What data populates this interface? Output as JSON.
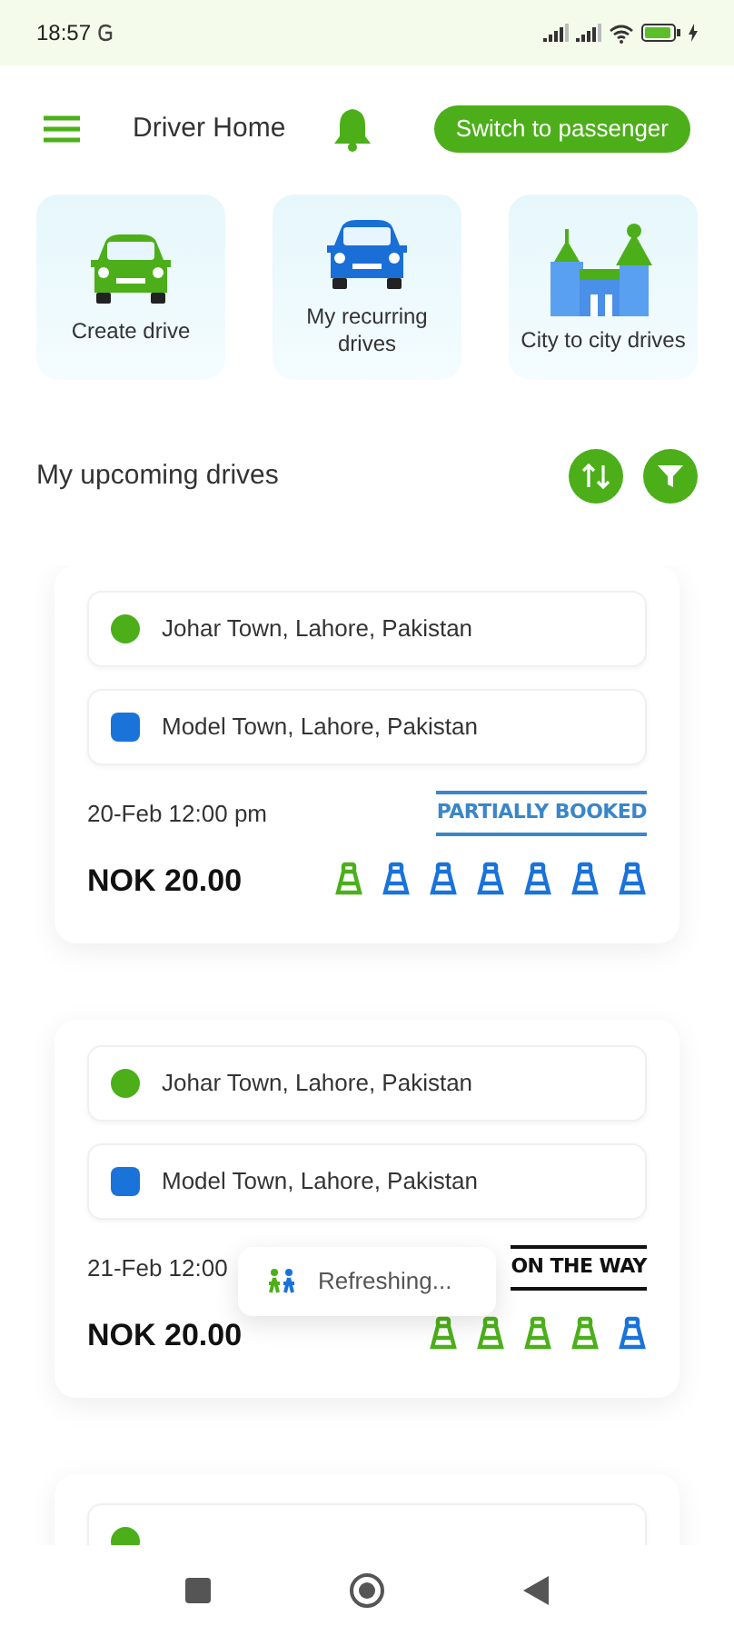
{
  "status_bar": {
    "time": "18:57"
  },
  "header": {
    "title": "Driver Home",
    "switch_button": "Switch to passenger"
  },
  "tiles": [
    {
      "label": "Create drive",
      "kind": "green-car"
    },
    {
      "label": "My recurring drives",
      "kind": "blue-car"
    },
    {
      "label": "City to city drives",
      "kind": "city"
    }
  ],
  "section": {
    "title": "My upcoming drives"
  },
  "drives": [
    {
      "stops": [
        {
          "kind": "origin",
          "color": "#4caf1a",
          "address": "Johar Town, Lahore, Pakistan"
        },
        {
          "kind": "destination",
          "color": "#1a73d9",
          "address": "Model Town, Lahore, Pakistan"
        }
      ],
      "date": "20-Feb 12:00 pm",
      "status": {
        "text": "PARTIALLY BOOKED",
        "color": "#3a86c9"
      },
      "price": "NOK 20.00",
      "seats": [
        {
          "booked": true
        },
        {
          "booked": false
        },
        {
          "booked": false
        },
        {
          "booked": false
        },
        {
          "booked": false
        },
        {
          "booked": false
        },
        {
          "booked": false
        }
      ]
    },
    {
      "stops": [
        {
          "kind": "origin",
          "color": "#4caf1a",
          "address": "Johar Town, Lahore, Pakistan"
        },
        {
          "kind": "destination",
          "color": "#1a73d9",
          "address": "Model Town, Lahore, Pakistan"
        }
      ],
      "date": "21-Feb 12:00",
      "status": {
        "text": "ON THE WAY",
        "color": "#111111"
      },
      "price": "NOK 20.00",
      "seats": [
        {
          "booked": true
        },
        {
          "booked": true
        },
        {
          "booked": true
        },
        {
          "booked": true
        },
        {
          "booked": false
        }
      ]
    },
    {
      "stops": [
        {
          "kind": "origin",
          "color": "#4caf1a"
        }
      ]
    }
  ],
  "toast": {
    "text": "Refreshing..."
  }
}
